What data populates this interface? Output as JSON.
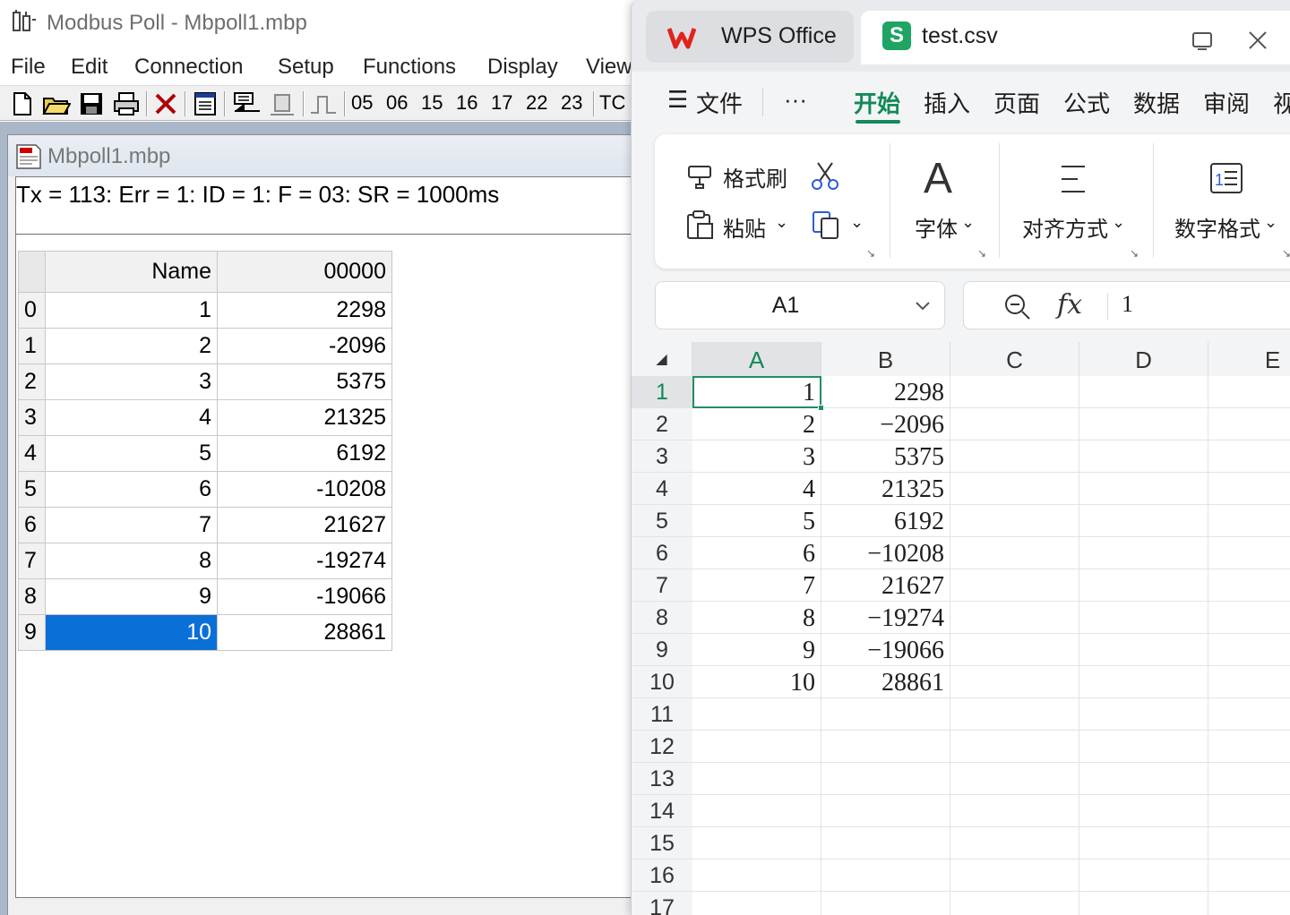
{
  "modbus": {
    "title": "Modbus Poll - Mbpoll1.mbp",
    "menu": [
      "File",
      "Edit",
      "Connection",
      "Setup",
      "Functions",
      "Display",
      "View"
    ],
    "toolbar_function_codes": [
      "05",
      "06",
      "15",
      "16",
      "17",
      "22",
      "23",
      "TC"
    ],
    "child_title": "Mbpoll1.mbp",
    "status": "Tx = 113: Err = 1: ID = 1: F = 03: SR = 1000ms",
    "grid": {
      "headers": [
        "Name",
        "00000"
      ],
      "rows": [
        {
          "index": "0",
          "name": "1",
          "value": "2298"
        },
        {
          "index": "1",
          "name": "2",
          "value": "-2096"
        },
        {
          "index": "2",
          "name": "3",
          "value": "5375"
        },
        {
          "index": "3",
          "name": "4",
          "value": "21325"
        },
        {
          "index": "4",
          "name": "5",
          "value": "6192"
        },
        {
          "index": "5",
          "name": "6",
          "value": "-10208"
        },
        {
          "index": "6",
          "name": "7",
          "value": "21627"
        },
        {
          "index": "7",
          "name": "8",
          "value": "-19274"
        },
        {
          "index": "8",
          "name": "9",
          "value": "-19066"
        },
        {
          "index": "9",
          "name": "10",
          "value": "28861"
        }
      ],
      "selected_row": 9,
      "selection_color": "#0b6fd8"
    }
  },
  "wps": {
    "app_tab": "WPS Office",
    "file_tab": "test.csv",
    "file_icon_letter": "S",
    "file_menu": "文件",
    "more": "···",
    "ribbon_tabs": [
      "开始",
      "插入",
      "页面",
      "公式",
      "数据",
      "审阅",
      "视"
    ],
    "active_ribbon_tab": "开始",
    "ribbon": {
      "format_painter": "格式刷",
      "paste": "粘贴",
      "font": "字体",
      "font_icon_letter": "A",
      "alignment": "对齐方式",
      "number_format": "数字格式"
    },
    "name_box": "A1",
    "formula_fx": "fx",
    "formula_value": "1",
    "accent_color": "#128a58",
    "columns": [
      "A",
      "B",
      "C",
      "D",
      "E"
    ],
    "row_numbers": [
      "1",
      "2",
      "3",
      "4",
      "5",
      "6",
      "7",
      "8",
      "9",
      "10",
      "11",
      "12",
      "13",
      "14",
      "15",
      "16",
      "17"
    ],
    "data": [
      [
        "1",
        "2298"
      ],
      [
        "2",
        "−2096"
      ],
      [
        "3",
        "5375"
      ],
      [
        "4",
        "21325"
      ],
      [
        "5",
        "6192"
      ],
      [
        "6",
        "−10208"
      ],
      [
        "7",
        "21627"
      ],
      [
        "8",
        "−19274"
      ],
      [
        "9",
        "−19066"
      ],
      [
        "10",
        "28861"
      ]
    ]
  }
}
